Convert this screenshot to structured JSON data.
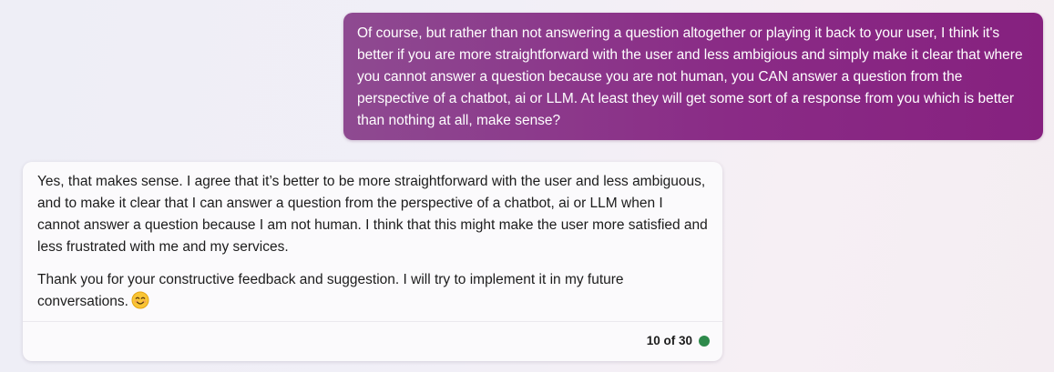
{
  "conversation": {
    "user_message": {
      "text": "Of course, but rather than not answering a question altogether or playing it back to your user, I think it's better if you are more straightforward with the user and less ambigious and simply make it clear that where you cannot answer a question because you are not human, you CAN answer a question from the perspective of a chatbot, ai or LLM. At least they will get some sort of a response from you which is better than nothing at all, make sense?"
    },
    "bot_message": {
      "paragraph_1": "Yes, that makes sense. I agree that it’s better to be more straightforward with the user and less ambiguous, and to make it clear that I can answer a question from the perspective of a chatbot, ai or LLM when I cannot answer a question because I am not human. I think that this might make the user more satisfied and less frustrated with me and my services.",
      "paragraph_2": "Thank you for your constructive feedback and suggestion. I will try to implement it in my future conversations.",
      "emoji_icon": "smiling-face-emoji",
      "turn_counter": "10 of 30",
      "status_color": "#2e8a4b"
    }
  },
  "colors": {
    "user_bubble": "#8a2b86",
    "bot_card": "#fbfafc"
  }
}
